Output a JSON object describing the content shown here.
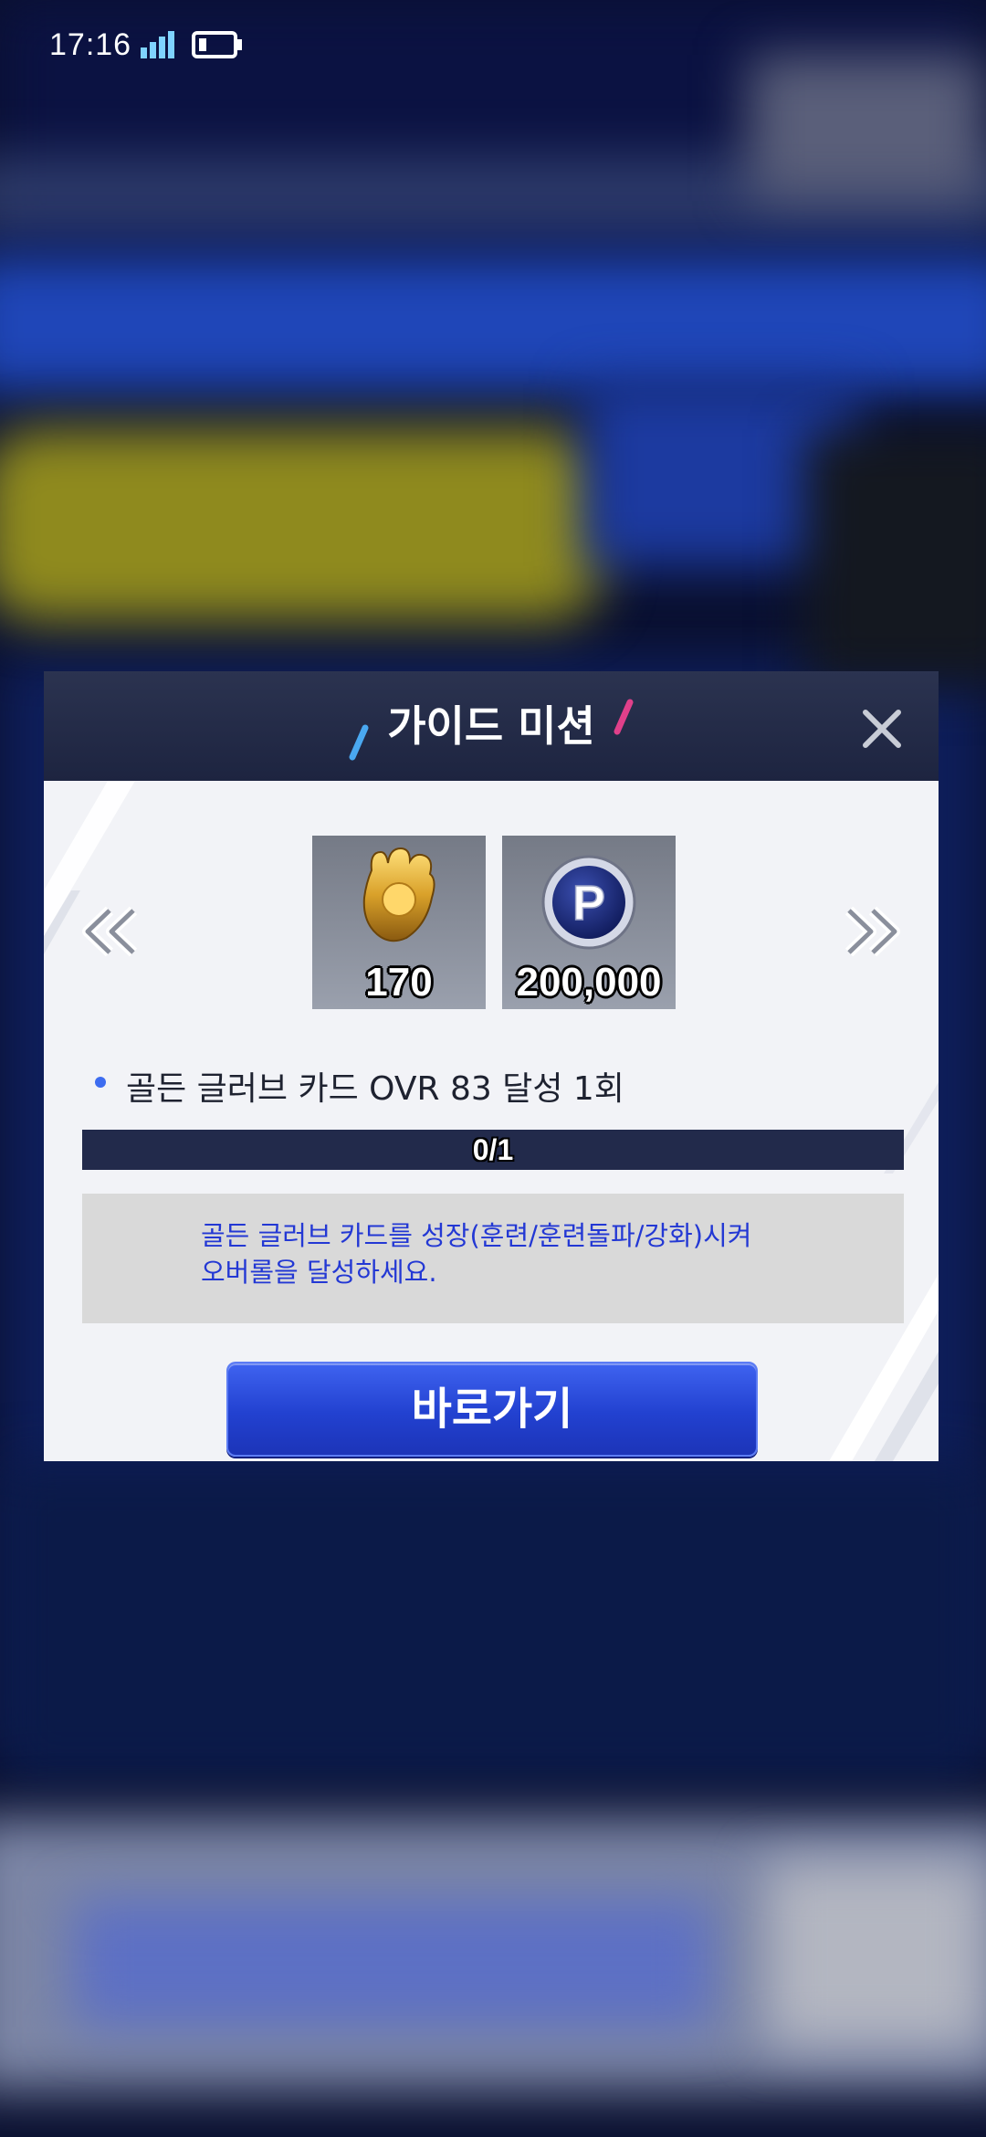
{
  "status_bar": {
    "time": "17:16"
  },
  "modal": {
    "title": "가이드 미션",
    "rewards": [
      {
        "icon": "golden-glove-icon",
        "count": "170"
      },
      {
        "icon": "point-coin-icon",
        "count": "200,000"
      }
    ],
    "mission": {
      "text": "골든 글러브 카드 OVR 83 달성 1회",
      "progress_text": "0/1",
      "progress_fraction": 0
    },
    "description": "골든 글러브 카드를 성장(훈련/훈련돌파/강화)시켜\n오버롤을 달성하세요.",
    "go_button_label": "바로가기"
  },
  "colors": {
    "accent_blue": "#2241d0",
    "header_bg": "#1d2440",
    "description_text": "#2338d4",
    "slash_left": "#4aa8f0",
    "slash_right": "#e0408a"
  }
}
